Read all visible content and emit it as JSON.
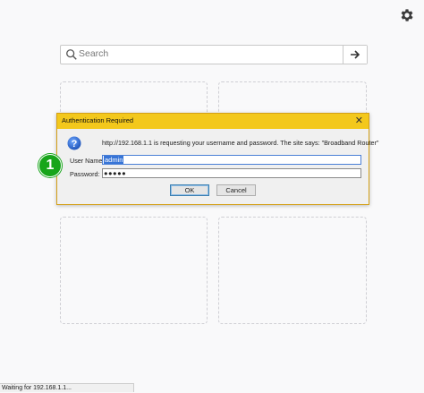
{
  "search": {
    "placeholder": "Search"
  },
  "dialog": {
    "title": "Authentication Required",
    "close_label": "✕",
    "message": "http://192.168.1.1 is requesting your username and password. The site says: \"Broadband Router\"",
    "username_label": "User Name:",
    "username_value": "admin",
    "password_label": "Password:",
    "password_value": "●●●●●",
    "ok_label": "OK",
    "cancel_label": "Cancel"
  },
  "annotation": {
    "step": "1",
    "color": "#17a51a"
  },
  "statusbar": {
    "text": "Waiting for 192.168.1.1..."
  },
  "colors": {
    "titlebar": "#f3c81c",
    "selection": "#3875d7"
  }
}
